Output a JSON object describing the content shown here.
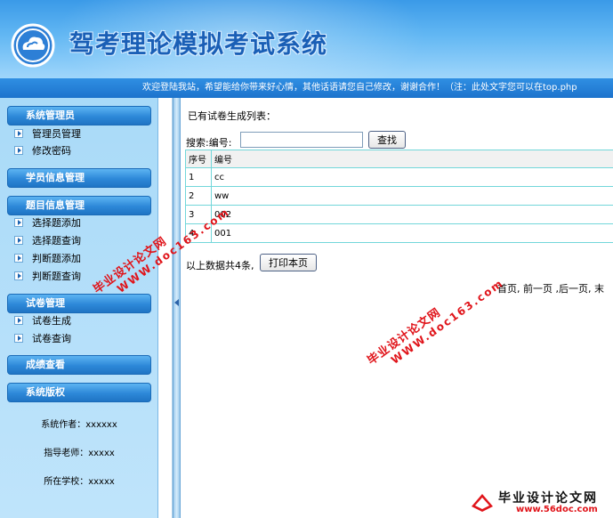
{
  "header": {
    "title": "驾考理论模拟考试系统"
  },
  "marquee": {
    "text": "欢迎登陆我站，希望能给你带来好心情，其他话语请您自己修改，谢谢合作！（注：此处文字您可以在top.php"
  },
  "sidebar": {
    "sections": [
      {
        "label": "系统管理员",
        "items": [
          "管理员管理",
          "修改密码"
        ]
      },
      {
        "label": "学员信息管理",
        "items": []
      },
      {
        "label": "题目信息管理",
        "items": [
          "选择题添加",
          "选择题查询",
          "判断题添加",
          "判断题查询"
        ]
      },
      {
        "label": "试卷管理",
        "items": [
          "试卷生成",
          "试卷查询"
        ]
      },
      {
        "label": "成绩查看",
        "items": []
      },
      {
        "label": "系统版权",
        "items": []
      }
    ],
    "copyright": {
      "author": "系统作者：xxxxxx",
      "advisor": "指导老师：xxxxx",
      "school": "所在学校：xxxxx"
    }
  },
  "main": {
    "list_title": "已有试卷生成列表：",
    "search_label": "搜索:编号:",
    "search_value": "",
    "search_button": "查找",
    "columns": [
      "序号",
      "编号"
    ],
    "rows": [
      {
        "idx": "1",
        "code": "cc"
      },
      {
        "idx": "2",
        "code": "ww"
      },
      {
        "idx": "3",
        "code": "002"
      },
      {
        "idx": "4",
        "code": "001"
      }
    ],
    "summary": "以上数据共4条,",
    "print_button": "打印本页",
    "pager": "首页, 前一页 ,后一页, 末"
  },
  "watermarks": {
    "line1": "毕业设计论文网",
    "line2": "WWW.doc163.com",
    "corner_title": "毕业设计论文网",
    "corner_url": "www.56doc.com"
  },
  "colors": {
    "header_blue": "#3a9ae8",
    "title_blue": "#1a5fb6",
    "section_blue": "#2d88d8",
    "watermark_red": "#e0141a",
    "table_border": "#72d7da"
  }
}
